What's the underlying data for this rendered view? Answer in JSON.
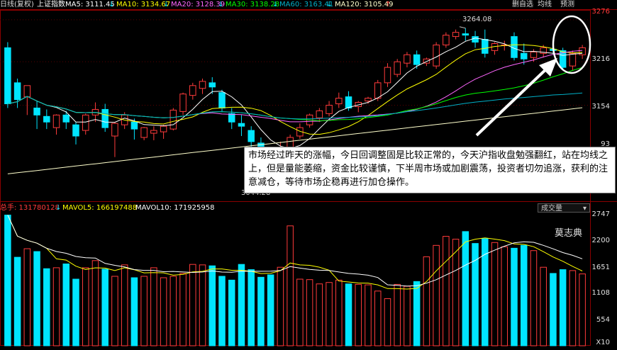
{
  "header": {
    "mode": "日线(复权)",
    "index_name": "上证指数",
    "ma5": "MA5: 3111.45",
    "ma10": "MA10: 3134.67",
    "ma20": "MA20: 3128.39",
    "ma30": "MA30: 3138.28",
    "ma60": "MA60: 3163.41",
    "ma120": "MA120: 3105.49",
    "arrow_down": "↓",
    "arrow_up": "↑"
  },
  "toolbar": {
    "item1": "删自选",
    "item2": "均线",
    "item3": "预测"
  },
  "price_axis": {
    "labels": [
      "3276",
      "3216",
      "3154"
    ],
    "partial_label": "93"
  },
  "annotations": {
    "high": "3264.08",
    "low": "3044.28",
    "note": "市场经过昨天的涨幅，今日回调整固是比较正常的，今天沪指收盘勉强翻红，站在均线之上，但是量能萎缩，资金比较谨慎，下半周市场或加剧震荡，投资者切勿追涨，获利的注意减仓，等待市场企稳再进行加仓操作。",
    "signature": "莫志典"
  },
  "volume_header": {
    "total": "总手: 131780128",
    "mavol5": "MAVOL5: 166197488",
    "mavol10": "MAVOL10: 171925958",
    "arrow_down": "↓",
    "dropdown": "成交量"
  },
  "volume_axis": {
    "labels": [
      "2747",
      "2200",
      "1651",
      "1108",
      "554",
      "X10"
    ]
  },
  "colors": {
    "up": "#ff3b3b",
    "down": "#00e5ff",
    "ma5": "#ffffff",
    "ma10": "#ffff00",
    "ma20": "#ff66ff",
    "ma30": "#00ff00",
    "ma60": "#00b0c8",
    "ma120": "#ffffcc"
  },
  "chart_data": {
    "type": "candlestick",
    "y_range": [
      3020,
      3290
    ],
    "candles": [
      {
        "o": 3236,
        "h": 3244,
        "c": 3156,
        "l": 3150
      },
      {
        "o": 3186,
        "h": 3192,
        "c": 3162,
        "l": 3150
      },
      {
        "o": 3166,
        "h": 3172,
        "c": 3182,
        "l": 3140
      },
      {
        "o": 3150,
        "h": 3160,
        "c": 3140,
        "l": 3120
      },
      {
        "o": 3138,
        "h": 3148,
        "c": 3130,
        "l": 3120
      },
      {
        "o": 3122,
        "h": 3141,
        "c": 3140,
        "l": 3112
      },
      {
        "o": 3140,
        "h": 3146,
        "c": 3130,
        "l": 3120
      },
      {
        "o": 3126,
        "h": 3130,
        "c": 3110,
        "l": 3098
      },
      {
        "o": 3118,
        "h": 3142,
        "c": 3140,
        "l": 3112
      },
      {
        "o": 3140,
        "h": 3158,
        "c": 3148,
        "l": 3130
      },
      {
        "o": 3148,
        "h": 3156,
        "c": 3122,
        "l": 3116
      },
      {
        "o": 3110,
        "h": 3130,
        "c": 3128,
        "l": 3080
      },
      {
        "o": 3126,
        "h": 3144,
        "c": 3140,
        "l": 3120
      },
      {
        "o": 3130,
        "h": 3135,
        "c": 3120,
        "l": 3105
      },
      {
        "o": 3108,
        "h": 3123,
        "c": 3122,
        "l": 3104
      },
      {
        "o": 3114,
        "h": 3124,
        "c": 3118,
        "l": 3104
      },
      {
        "o": 3116,
        "h": 3126,
        "c": 3124,
        "l": 3106
      },
      {
        "o": 3120,
        "h": 3150,
        "c": 3147,
        "l": 3118
      },
      {
        "o": 3145,
        "h": 3172,
        "c": 3170,
        "l": 3140
      },
      {
        "o": 3168,
        "h": 3186,
        "c": 3182,
        "l": 3162
      },
      {
        "o": 3178,
        "h": 3192,
        "c": 3188,
        "l": 3170
      },
      {
        "o": 3186,
        "h": 3194,
        "c": 3180,
        "l": 3170
      },
      {
        "o": 3172,
        "h": 3176,
        "c": 3150,
        "l": 3144
      },
      {
        "o": 3142,
        "h": 3150,
        "c": 3130,
        "l": 3120
      },
      {
        "o": 3128,
        "h": 3140,
        "c": 3124,
        "l": 3110
      },
      {
        "o": 3118,
        "h": 3124,
        "c": 3102,
        "l": 3080
      },
      {
        "o": 3100,
        "h": 3108,
        "c": 3090,
        "l": 3060
      },
      {
        "o": 3088,
        "h": 3094,
        "c": 3076,
        "l": 3060
      },
      {
        "o": 3060,
        "h": 3102,
        "c": 3086,
        "l": 3044
      },
      {
        "o": 3090,
        "h": 3112,
        "c": 3108,
        "l": 3086
      },
      {
        "o": 3110,
        "h": 3128,
        "c": 3122,
        "l": 3106
      },
      {
        "o": 3126,
        "h": 3142,
        "c": 3140,
        "l": 3122
      },
      {
        "o": 3136,
        "h": 3150,
        "c": 3146,
        "l": 3130
      },
      {
        "o": 3142,
        "h": 3160,
        "c": 3154,
        "l": 3138
      },
      {
        "o": 3156,
        "h": 3172,
        "c": 3164,
        "l": 3150
      },
      {
        "o": 3166,
        "h": 3174,
        "c": 3150,
        "l": 3146
      },
      {
        "o": 3152,
        "h": 3160,
        "c": 3158,
        "l": 3144
      },
      {
        "o": 3160,
        "h": 3166,
        "c": 3164,
        "l": 3156
      },
      {
        "o": 3164,
        "h": 3190,
        "c": 3186,
        "l": 3160
      },
      {
        "o": 3186,
        "h": 3214,
        "c": 3208,
        "l": 3180
      },
      {
        "o": 3198,
        "h": 3220,
        "c": 3216,
        "l": 3194
      },
      {
        "o": 3214,
        "h": 3230,
        "c": 3226,
        "l": 3208
      },
      {
        "o": 3226,
        "h": 3232,
        "c": 3212,
        "l": 3206
      },
      {
        "o": 3214,
        "h": 3222,
        "c": 3220,
        "l": 3210
      },
      {
        "o": 3210,
        "h": 3244,
        "c": 3240,
        "l": 3206
      },
      {
        "o": 3240,
        "h": 3258,
        "c": 3254,
        "l": 3236
      },
      {
        "o": 3252,
        "h": 3262,
        "c": 3258,
        "l": 3248
      },
      {
        "o": 3256,
        "h": 3264,
        "c": 3254,
        "l": 3246
      },
      {
        "o": 3252,
        "h": 3260,
        "c": 3244,
        "l": 3236
      },
      {
        "o": 3248,
        "h": 3262,
        "c": 3228,
        "l": 3222
      },
      {
        "o": 3232,
        "h": 3244,
        "c": 3242,
        "l": 3226
      },
      {
        "o": 3240,
        "h": 3246,
        "c": 3240,
        "l": 3232
      },
      {
        "o": 3252,
        "h": 3258,
        "c": 3222,
        "l": 3218
      },
      {
        "o": 3228,
        "h": 3242,
        "c": 3220,
        "l": 3212
      },
      {
        "o": 3222,
        "h": 3234,
        "c": 3230,
        "l": 3216
      },
      {
        "o": 3228,
        "h": 3240,
        "c": 3236,
        "l": 3222
      },
      {
        "o": 3234,
        "h": 3240,
        "c": 3232,
        "l": 3226
      },
      {
        "o": 3232,
        "h": 3236,
        "c": 3208,
        "l": 3204
      },
      {
        "o": 3210,
        "h": 3232,
        "c": 3228,
        "l": 3204
      },
      {
        "o": 3226,
        "h": 3240,
        "c": 3236,
        "l": 3220
      }
    ],
    "volume": [
      2747,
      1860,
      2040,
      1980,
      1620,
      1640,
      1720,
      1400,
      1640,
      1790,
      1610,
      1460,
      1700,
      1430,
      1460,
      1640,
      1430,
      1460,
      1520,
      1710,
      1700,
      1680,
      1460,
      1380,
      1710,
      1600,
      1440,
      1490,
      1650,
      2520,
      1400,
      1390,
      1300,
      1330,
      1380,
      1300,
      1290,
      1280,
      1150,
      990,
      1290,
      1250,
      1350,
      1870,
      2110,
      2300,
      2240,
      2400,
      2150,
      2250,
      2170,
      2080,
      2050,
      2110,
      2000,
      1650,
      1520,
      1600,
      1580,
      1510
    ],
    "vol_range": [
      0,
      2800
    ]
  }
}
